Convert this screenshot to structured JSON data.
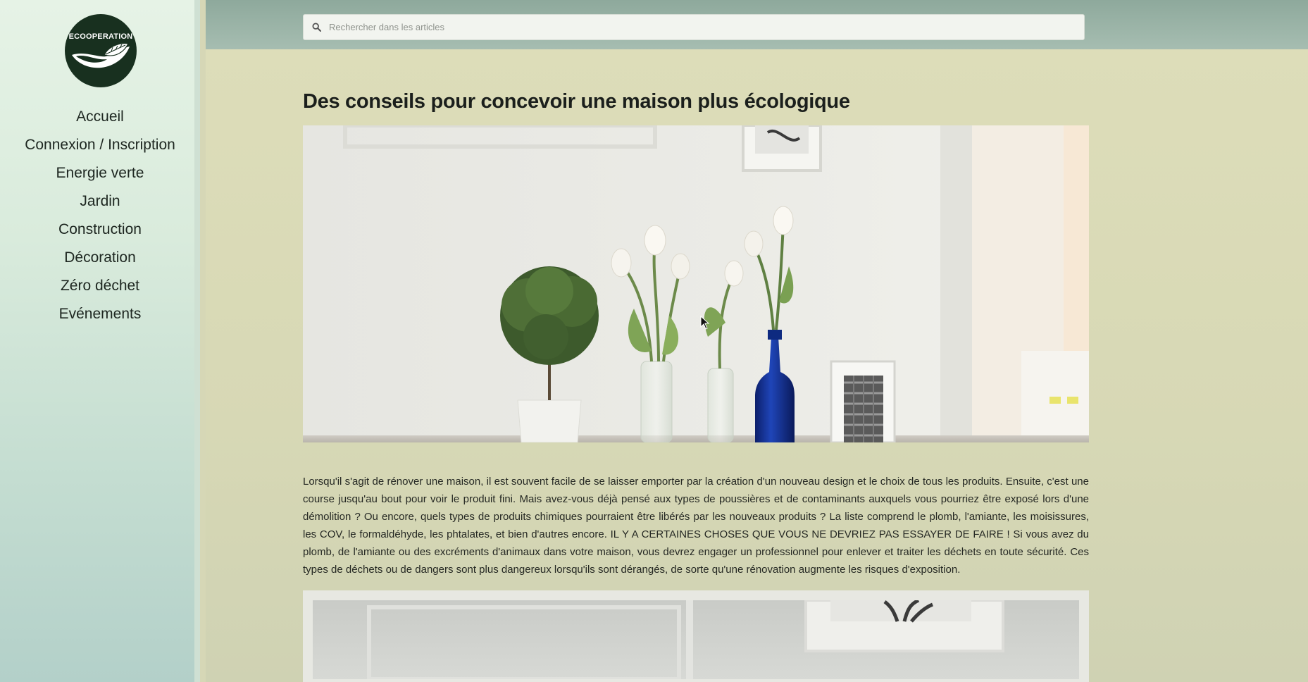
{
  "sidebar": {
    "logo_text": "ECOOPERATION",
    "items": [
      {
        "label": "Accueil"
      },
      {
        "label": "Connexion / Inscription"
      },
      {
        "label": "Energie verte"
      },
      {
        "label": "Jardin"
      },
      {
        "label": "Construction"
      },
      {
        "label": "Décoration"
      },
      {
        "label": "Zéro déchet"
      },
      {
        "label": "Evénements"
      }
    ]
  },
  "search": {
    "placeholder": "Rechercher dans les articles",
    "value": "",
    "icon": "search-icon"
  },
  "article": {
    "title": "Des conseils pour concevoir une maison plus écologique",
    "paragraph": "Lorsqu'il s'agit de rénover une maison, il est souvent facile de se laisser emporter par la création d'un nouveau design et le choix de tous les produits. Ensuite, c'est une course jusqu'au bout pour voir le produit fini. Mais avez-vous déjà pensé aux types de poussières et de contaminants auxquels vous pourriez être exposé lors d'une démolition ? Ou encore, quels types de produits chimiques pourraient être libérés par les nouveaux produits ? La liste comprend le plomb, l'amiante, les moisissures, les COV, le formaldéhyde, les phtalates, et bien d'autres encore. IL Y A CERTAINES CHOSES QUE VOUS NE DEVRIEZ PAS ESSAYER DE FAIRE ! Si vous avez du plomb, de l'amiante ou des excréments d'animaux dans votre maison, vous devrez engager un professionnel pour enlever et traiter les déchets en toute sécurité. Ces types de déchets ou de dangers sont plus dangereux lorsqu'ils sont dérangés, de sorte qu'une rénovation augmente les risques d'exposition."
  },
  "colors": {
    "sidebar_bg": "#dcefdf",
    "header_bg": "#9cb5a8",
    "main_bg": "#d9dab7",
    "logo_bg": "#18301f",
    "text": "#1d2620",
    "vase_blue": "#1a3aa0"
  }
}
